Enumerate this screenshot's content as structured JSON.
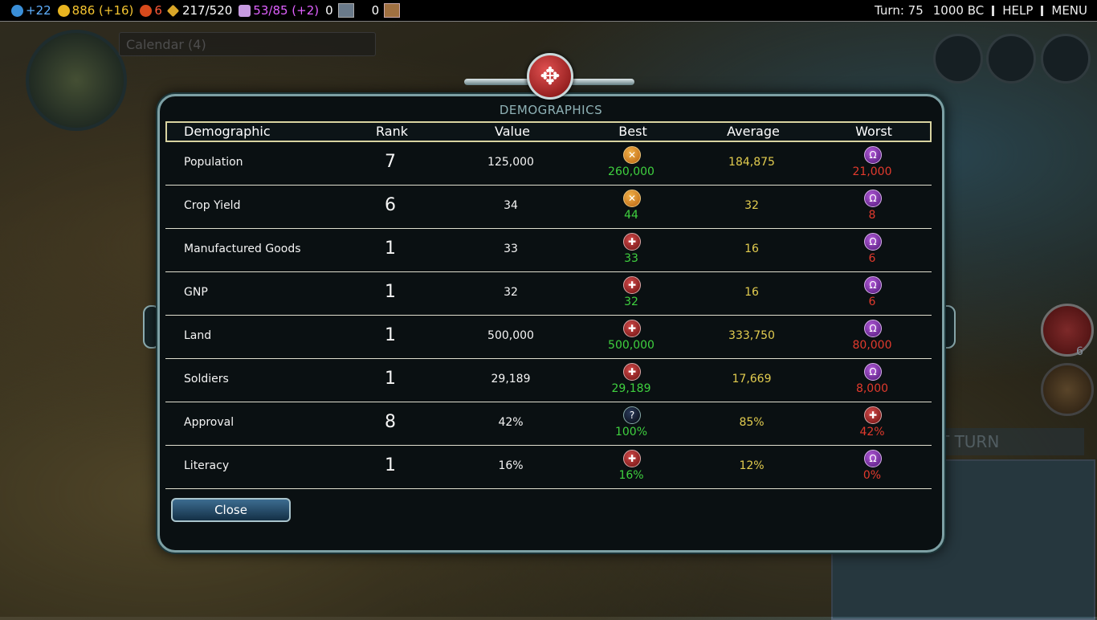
{
  "topbar": {
    "science": "+22",
    "gold": "886 (+16)",
    "happiness": "6",
    "culture": "217/520",
    "faith": "53/85 (+2)",
    "trade_routes": "0",
    "tourism": "0",
    "turn": "Turn: 75",
    "year": "1000 BC",
    "help": "HELP",
    "menu": "MENU"
  },
  "background": {
    "calendar_label": "Calendar (4)",
    "next_turn_label": "T TURN",
    "unit_count": "6"
  },
  "dialog": {
    "title": "DEMOGRAPHICS",
    "close_label": "Close"
  },
  "table": {
    "headers": [
      "Demographic",
      "Rank",
      "Value",
      "Best",
      "Average",
      "Worst"
    ],
    "rows": [
      {
        "name": "Population",
        "rank": "7",
        "value": "125,000",
        "best_icon": "orange-civ-icon",
        "best": "260,000",
        "average": "184,875",
        "worst_icon": "purple-civ-icon",
        "worst": "21,000"
      },
      {
        "name": "Crop Yield",
        "rank": "6",
        "value": "34",
        "best_icon": "orange-civ-icon",
        "best": "44",
        "average": "32",
        "worst_icon": "purple-civ-icon",
        "worst": "8"
      },
      {
        "name": "Manufactured Goods",
        "rank": "1",
        "value": "33",
        "best_icon": "red-civ-icon",
        "best": "33",
        "average": "16",
        "worst_icon": "purple-civ-icon",
        "worst": "6"
      },
      {
        "name": "GNP",
        "rank": "1",
        "value": "32",
        "best_icon": "red-civ-icon",
        "best": "32",
        "average": "16",
        "worst_icon": "purple-civ-icon",
        "worst": "6"
      },
      {
        "name": "Land",
        "rank": "1",
        "value": "500,000",
        "best_icon": "red-civ-icon",
        "best": "500,000",
        "average": "333,750",
        "worst_icon": "purple-civ-icon",
        "worst": "80,000"
      },
      {
        "name": "Soldiers",
        "rank": "1",
        "value": "29,189",
        "best_icon": "red-civ-icon",
        "best": "29,189",
        "average": "17,669",
        "worst_icon": "purple-civ-icon",
        "worst": "8,000"
      },
      {
        "name": "Approval",
        "rank": "8",
        "value": "42%",
        "best_icon": "unknown-civ-icon",
        "best": "100%",
        "average": "85%",
        "worst_icon": "red-civ-icon",
        "worst": "42%"
      },
      {
        "name": "Literacy",
        "rank": "1",
        "value": "16%",
        "best_icon": "red-civ-icon",
        "best": "16%",
        "average": "12%",
        "worst_icon": "purple-civ-icon",
        "worst": "0%"
      }
    ]
  },
  "colors": {
    "best": "#3fd13f",
    "average": "#e2cc4f",
    "worst": "#e23a2d",
    "science": "#5fb0ff",
    "gold": "#f4c430",
    "faith": "#e060ff"
  }
}
